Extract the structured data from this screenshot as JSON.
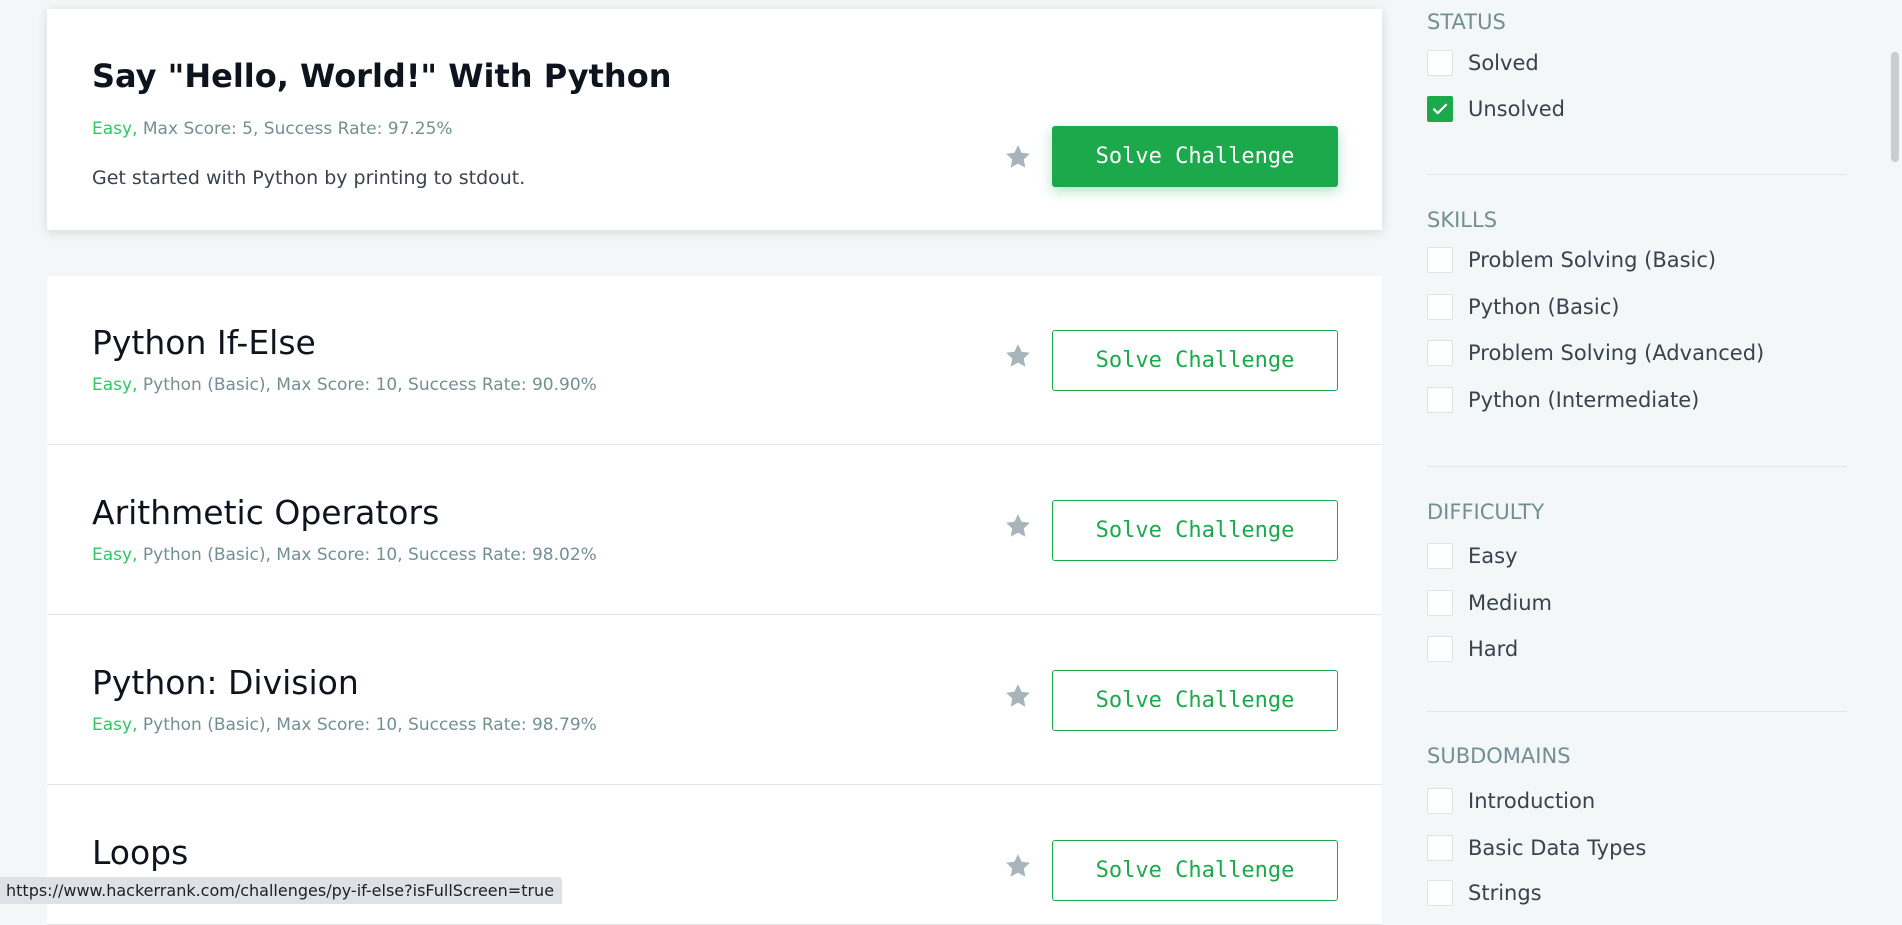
{
  "challenges": [
    {
      "title": "Say \"Hello, World!\" With Python",
      "difficulty": "Easy,",
      "meta": " Max Score: 5, Success Rate: 97.25%",
      "description": "Get started with Python by printing to stdout.",
      "button_label": "Solve Challenge"
    },
    {
      "title": "Python If-Else",
      "difficulty": "Easy,",
      "meta": " Python (Basic), Max Score: 10, Success Rate: 90.90%",
      "button_label": "Solve Challenge"
    },
    {
      "title": "Arithmetic Operators",
      "difficulty": "Easy,",
      "meta": " Python (Basic), Max Score: 10, Success Rate: 98.02%",
      "button_label": "Solve Challenge"
    },
    {
      "title": "Python: Division",
      "difficulty": "Easy,",
      "meta": " Python (Basic), Max Score: 10, Success Rate: 98.79%",
      "button_label": "Solve Challenge"
    },
    {
      "title": "Loops",
      "difficulty": "",
      "meta": "",
      "button_label": "Solve Challenge"
    }
  ],
  "filters": {
    "status": {
      "title": "STATUS",
      "options": [
        {
          "label": "Solved",
          "checked": false
        },
        {
          "label": "Unsolved",
          "checked": true
        }
      ]
    },
    "skills": {
      "title": "SKILLS",
      "options": [
        {
          "label": "Problem Solving (Basic)",
          "checked": false
        },
        {
          "label": "Python (Basic)",
          "checked": false
        },
        {
          "label": "Problem Solving (Advanced)",
          "checked": false
        },
        {
          "label": "Python (Intermediate)",
          "checked": false
        }
      ]
    },
    "difficulty": {
      "title": "DIFFICULTY",
      "options": [
        {
          "label": "Easy",
          "checked": false
        },
        {
          "label": "Medium",
          "checked": false
        },
        {
          "label": "Hard",
          "checked": false
        }
      ]
    },
    "subdomains": {
      "title": "SUBDOMAINS",
      "options": [
        {
          "label": "Introduction",
          "checked": false
        },
        {
          "label": "Basic Data Types",
          "checked": false
        },
        {
          "label": "Strings",
          "checked": false
        }
      ]
    }
  },
  "status_bar": {
    "url": "https://www.hackerrank.com/challenges/py-if-else?isFullScreen=true"
  },
  "colors": {
    "accent": "#1ba94c",
    "difficulty_easy": "#2ec866",
    "star": "#a7b4bb"
  },
  "icons": {
    "star": "star-icon",
    "check": "checkmark-icon"
  }
}
